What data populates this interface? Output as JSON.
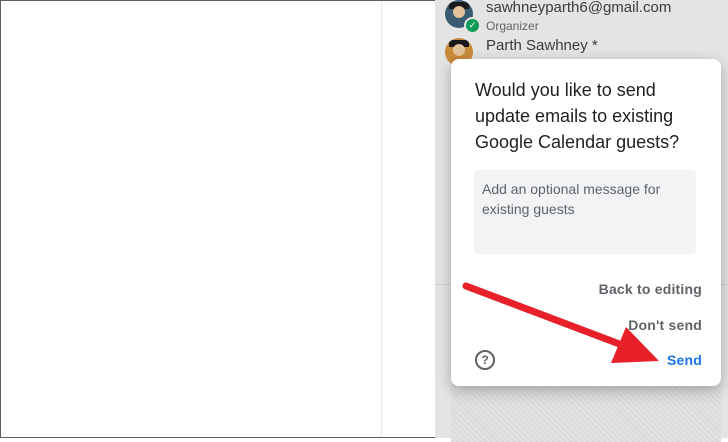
{
  "guests": [
    {
      "name": "sawhneyparth6@gmail.com",
      "role": "Organizer"
    },
    {
      "name": "Parth Sawhney *",
      "role": ""
    }
  ],
  "dialog": {
    "title": "Would you like to send update emails to existing Google Calendar guests?",
    "message_placeholder": "Add an optional message for existing guests",
    "back_label": "Back to editing",
    "dont_send_label": "Don't send",
    "send_label": "Send",
    "help_icon": "?"
  },
  "colors": {
    "accent": "#1a73e8",
    "annotation_arrow": "#e8202a"
  }
}
